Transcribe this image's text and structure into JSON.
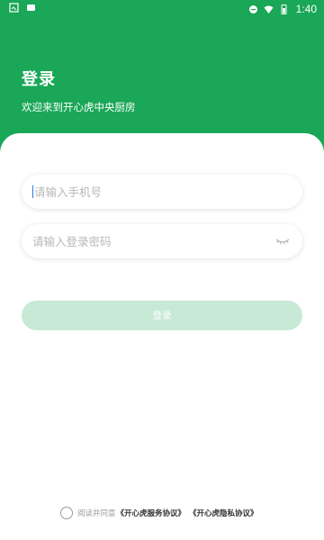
{
  "status_bar": {
    "left_icons": [
      "screenshot-icon",
      "notification-icon"
    ],
    "right_icons": [
      "dnd-icon",
      "wifi-icon",
      "battery-icon"
    ],
    "time": "1:40"
  },
  "header": {
    "title": "登录",
    "subtitle": "欢迎来到开心虎中央厨房"
  },
  "form": {
    "phone_placeholder": "请输入手机号",
    "password_placeholder": "请输入登录密码",
    "password_toggle_icon": "eye-closed-icon",
    "login_label": "登录"
  },
  "agreement": {
    "prefix": "阅读并同意",
    "service_link": "《开心虎服务协议》",
    "privacy_link": "《开心虎隐私协议》"
  },
  "colors": {
    "brand_green": "#1aa757",
    "button_disabled": "#c8e9d6",
    "cursor_blue": "#2f7de1"
  }
}
